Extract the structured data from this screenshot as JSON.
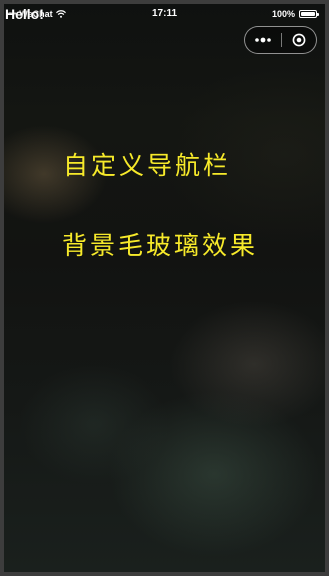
{
  "status_bar": {
    "signal": "•••••",
    "carrier": "WeChat",
    "time": "17:11",
    "battery": "100%"
  },
  "nav": {
    "title": "Hello!"
  },
  "content": {
    "line1": "自定义导航栏",
    "line2": "背景毛玻璃效果"
  },
  "colors": {
    "accent_text": "#f7ea2a",
    "status_text": "#ffffff"
  },
  "icons": {
    "wifi": "wifi-icon",
    "battery": "battery-icon",
    "more": "more-dots-icon",
    "close": "close-circle-icon"
  }
}
